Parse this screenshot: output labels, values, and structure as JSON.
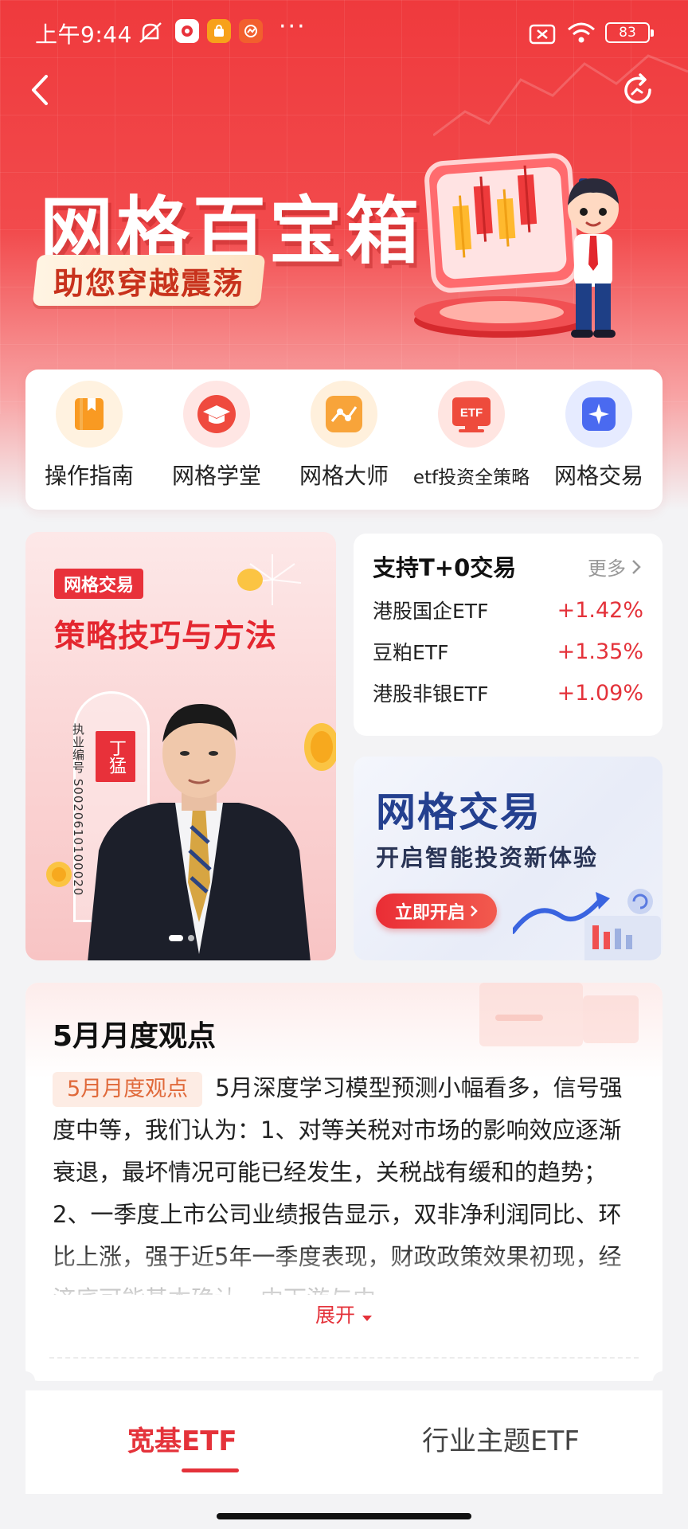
{
  "status_bar": {
    "time": "上午9:44",
    "battery": "83"
  },
  "hero": {
    "title": "网格百宝箱",
    "subtitle": "助您穿越震荡"
  },
  "quick_menu": [
    {
      "label": "操作指南",
      "icon": "book-icon",
      "color": "#f99a22"
    },
    {
      "label": "网格学堂",
      "icon": "graduation-cap-icon",
      "color": "#ef4a3e"
    },
    {
      "label": "网格大师",
      "icon": "trend-line-icon",
      "color": "#f8a43a"
    },
    {
      "label": "etf投资全策略",
      "icon": "etf-icon",
      "color": "#ee4b3c",
      "icon_text": "ETF"
    },
    {
      "label": "网格交易",
      "icon": "grid-trade-icon",
      "color": "#4a6af0"
    }
  ],
  "promo": {
    "tag": "网格交易",
    "title": "策略技巧与方法",
    "name": "丁猛",
    "license": "执业编号 S0020610100020"
  },
  "t0": {
    "title": "支持T+0交易",
    "more": "更多",
    "items": [
      {
        "name": "港股国企ETF",
        "change": "+1.42%"
      },
      {
        "name": "豆粕ETF",
        "change": "+1.35%"
      },
      {
        "name": "港股非银ETF",
        "change": "+1.09%"
      }
    ]
  },
  "grid_banner": {
    "title": "网格交易",
    "subtitle": "开启智能投资新体验",
    "button": "立即开启"
  },
  "monthly": {
    "title": "5月月度观点",
    "tag": "5月月度观点",
    "text": "5月深度学习模型预测小幅看多，信号强度中等，我们认为：1、对等关税对市场的影响效应逐渐衰退，最坏情况可能已经发生，关税战有缓和的趋势；2、一季度上市公司业绩报告显示，双非净利润同比、环比上涨，强于近5年一季度表现，财政政策效果初现，经济底可能基本确认，中下游与中...",
    "expand": "展开"
  },
  "tabs": [
    {
      "label": "宽基ETF",
      "active": true
    },
    {
      "label": "行业主题ETF",
      "active": false
    }
  ],
  "colors": {
    "accent": "#e4323a",
    "hero": "#ef3a3d",
    "banner_title": "#24408f"
  }
}
